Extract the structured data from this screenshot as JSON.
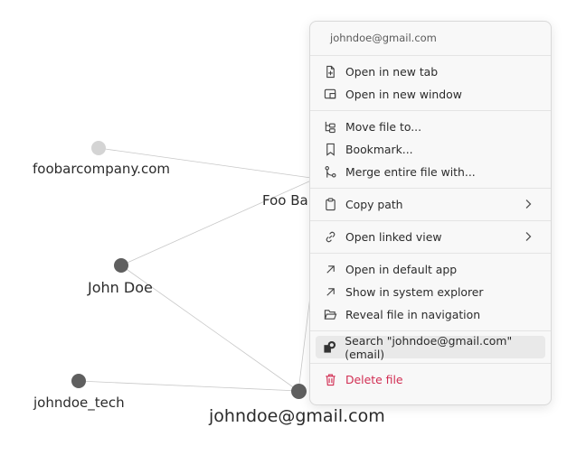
{
  "graph": {
    "nodes": [
      {
        "id": "foobarcompany",
        "label": "foobarcompany.com"
      },
      {
        "id": "foobar",
        "label": "Foo Bar"
      },
      {
        "id": "johndoe",
        "label": "John Doe"
      },
      {
        "id": "johndoe_tech",
        "label": "johndoe_tech"
      },
      {
        "id": "email",
        "label": "johndoe@gmail.com"
      }
    ]
  },
  "context_menu": {
    "header": "johndoe@gmail.com",
    "sections": [
      [
        {
          "icon": "file-plus-icon",
          "label": "Open in new tab"
        },
        {
          "icon": "window-icon",
          "label": "Open in new window"
        }
      ],
      [
        {
          "icon": "folder-tree-icon",
          "label": "Move file to..."
        },
        {
          "icon": "bookmark-icon",
          "label": "Bookmark..."
        },
        {
          "icon": "git-merge-icon",
          "label": "Merge entire file with..."
        }
      ],
      [
        {
          "icon": "clipboard-icon",
          "label": "Copy path",
          "submenu": true
        }
      ],
      [
        {
          "icon": "link-icon",
          "label": "Open linked view",
          "submenu": true
        }
      ],
      [
        {
          "icon": "arrow-up-right-icon",
          "label": "Open in default app"
        },
        {
          "icon": "arrow-up-right-icon",
          "label": "Show in system explorer"
        },
        {
          "icon": "folder-open-icon",
          "label": "Reveal file in navigation"
        }
      ],
      [
        {
          "icon": "search-shape-icon",
          "label": "Search \"johndoe@gmail.com\" (email)",
          "highlighted": true
        }
      ],
      [
        {
          "icon": "trash-icon",
          "label": "Delete file",
          "danger": true
        }
      ]
    ]
  },
  "colors": {
    "danger": "#d12d52",
    "node_dark": "#5f5f5f",
    "node_light": "#d4d4d4",
    "edge": "#c8c8c8"
  }
}
